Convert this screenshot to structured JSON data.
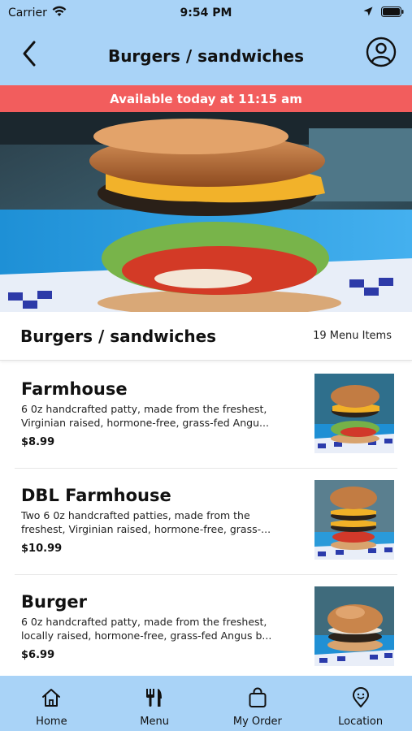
{
  "status_bar": {
    "carrier": "Carrier",
    "time": "9:54 PM"
  },
  "header": {
    "title": "Burgers / sandwiches",
    "back_icon": "chevron-left-icon",
    "account_icon": "user-circle-icon"
  },
  "banner": {
    "text": "Available today at 11:15 am",
    "color": "#f25d5d"
  },
  "section": {
    "title": "Burgers / sandwiches",
    "count": "19 Menu Items"
  },
  "menu_items": [
    {
      "name": "Farmhouse",
      "description": "6 0z handcrafted patty, made from the freshest, Virginian raised, hormone-free, grass-fed Angu...",
      "price": "$8.99"
    },
    {
      "name": "DBL Farmhouse",
      "description": "Two 6 0z handcrafted patties, made from the freshest, Virginian raised, hormone-free, grass-...",
      "price": "$10.99"
    },
    {
      "name": "Burger",
      "description": "6 0z handcrafted patty, made from the freshest, locally raised, hormone-free, grass-fed Angus b...",
      "price": "$6.99"
    }
  ],
  "tab_bar": {
    "tabs": [
      {
        "label": "Home",
        "icon": "home-icon"
      },
      {
        "label": "Menu",
        "icon": "fork-knife-icon"
      },
      {
        "label": "My Order",
        "icon": "shopping-bag-icon"
      },
      {
        "label": "Location",
        "icon": "location-pin-icon"
      }
    ]
  },
  "colors": {
    "header_bg": "#a9d3f7",
    "banner_bg": "#f25d5d",
    "text": "#111111"
  }
}
